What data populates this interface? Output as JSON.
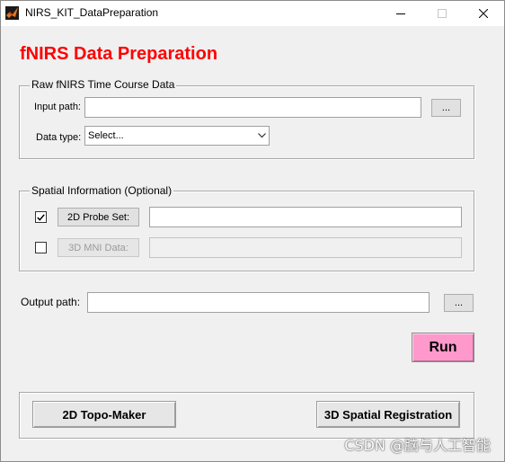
{
  "window": {
    "title": "NIRS_KIT_DataPreparation",
    "controls": {
      "minimize": "minimize",
      "maximize": "maximize",
      "close": "close"
    }
  },
  "main_title": "fNIRS Data Preparation",
  "raw_data": {
    "group_title": "Raw fNIRS Time Course Data",
    "input_path_label": "Input path:",
    "input_path_value": "",
    "browse_label": "...",
    "data_type_label": "Data type:",
    "data_type_selected": "Select..."
  },
  "spatial": {
    "group_title": "Spatial Information (Optional)",
    "probe_set": {
      "checked": true,
      "button_label": "2D Probe Set:",
      "value": ""
    },
    "mni_data": {
      "checked": false,
      "button_label": "3D MNI Data:",
      "value": ""
    }
  },
  "output": {
    "label": "Output path:",
    "value": "",
    "browse_label": "..."
  },
  "run_label": "Run",
  "bottom": {
    "topo_maker_label": "2D Topo-Maker",
    "spatial_registration_label": "3D Spatial Registration"
  },
  "watermark": "CSDN @脑与人工智能",
  "colors": {
    "title_red": "#ff0000",
    "run_pink": "#ff99cc",
    "background": "#f0f0f0"
  }
}
